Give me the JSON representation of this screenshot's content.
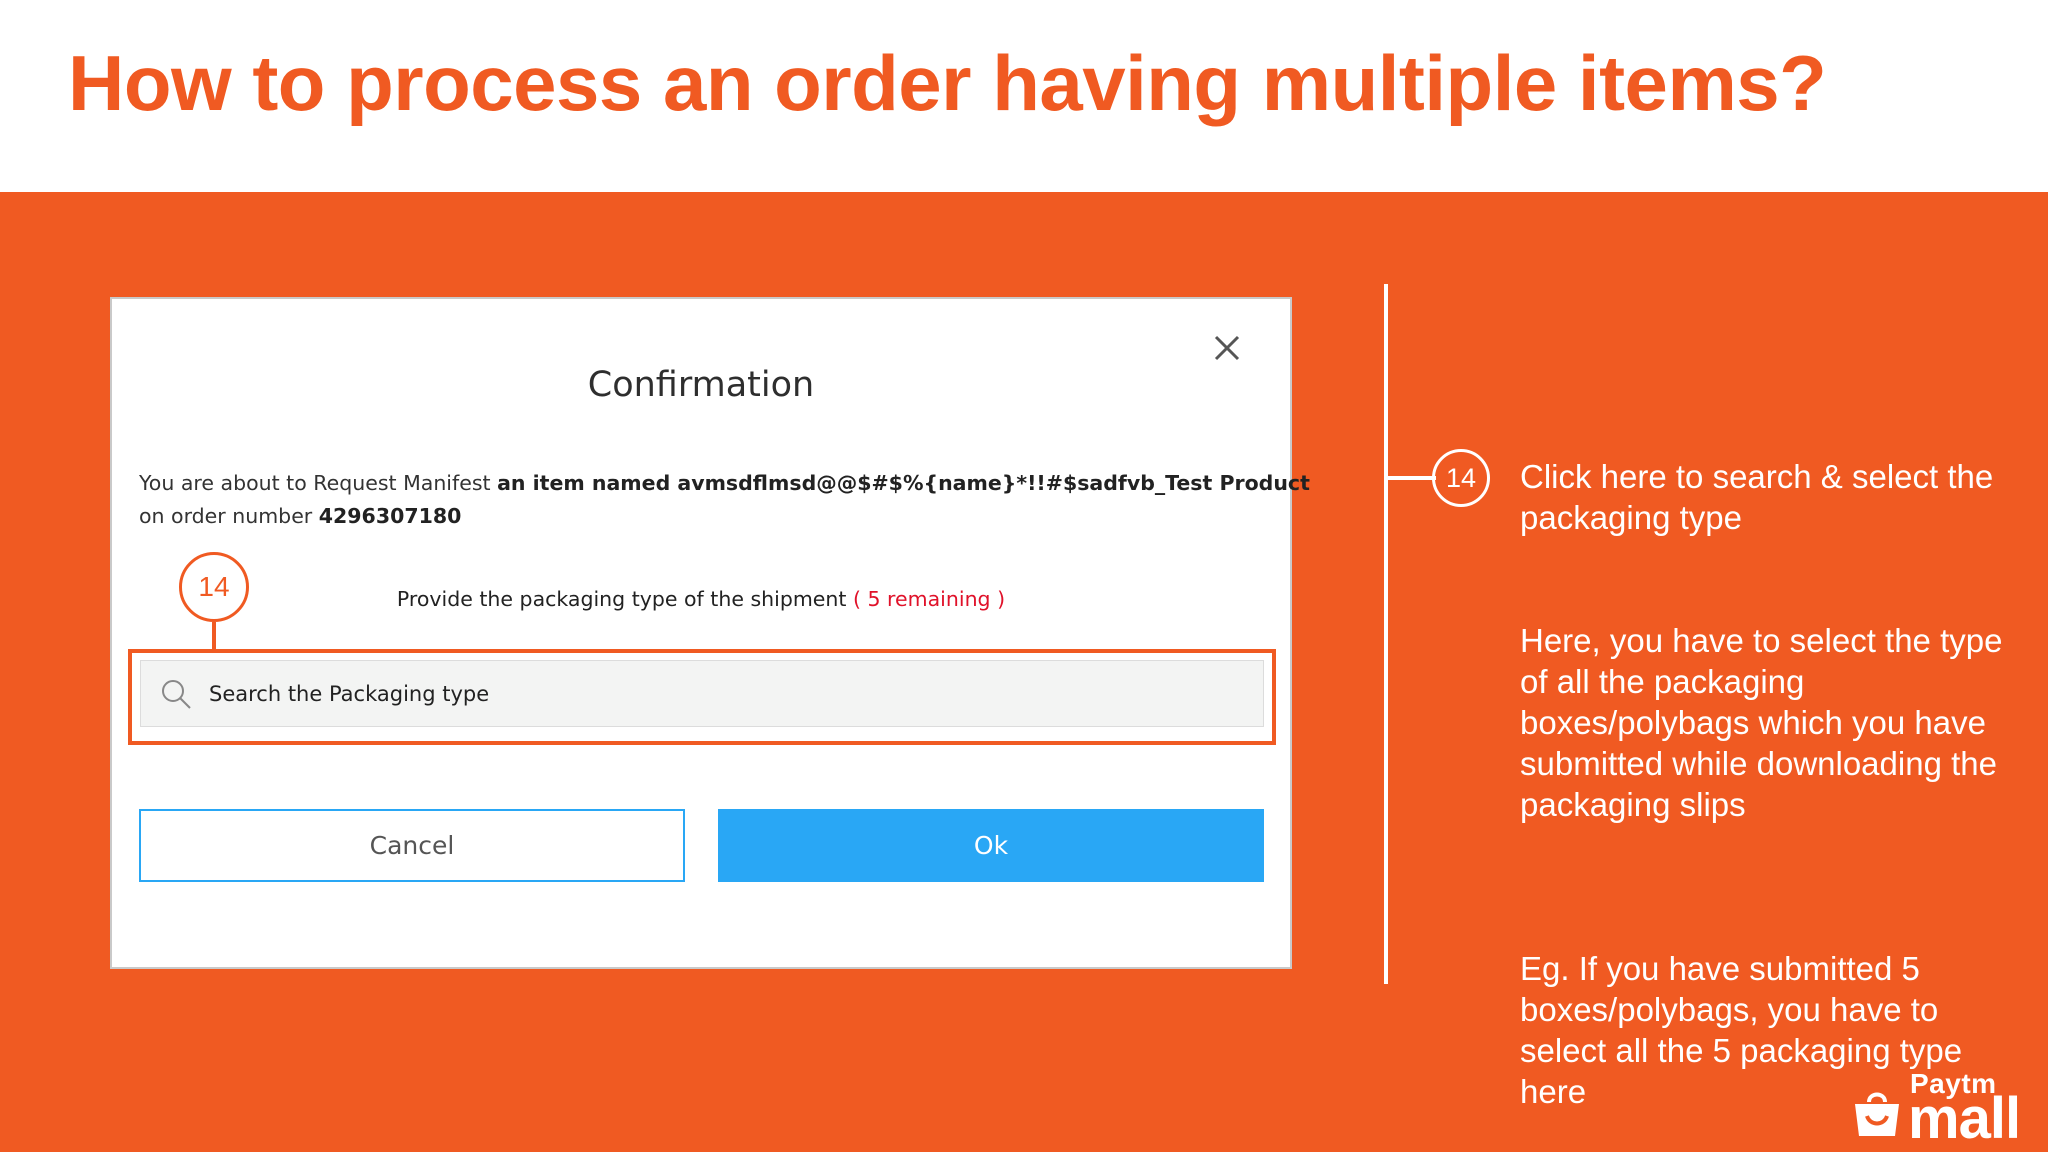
{
  "slide": {
    "title": "How to process an order having multiple items?"
  },
  "dialog": {
    "title": "Confirmation",
    "message_prefix": "You are about to Request Manifest ",
    "message_item": "an item named avmsdflmsd@@$#$%{name}*!!#$sadfvb_Test Product",
    "message_order_prefix": "on order number ",
    "order_number": "4296307180",
    "packaging_prompt": "Provide the packaging type of the shipment",
    "remaining": "( 5 remaining )",
    "search_placeholder": "Search the Packaging type",
    "cancel_label": "Cancel",
    "ok_label": "Ok",
    "callout_number": "14"
  },
  "annotations": {
    "step_number": "14",
    "note_1": "Click here to search & select the packaging type",
    "note_2": "Here, you have to select the type of all the packaging boxes/polybags which you have submitted while downloading the packaging slips",
    "note_3": "Eg. If you have submitted 5 boxes/polybags, you have to select all the 5 packaging type here"
  },
  "logo": {
    "line1": "Paytm",
    "line2": "mall"
  },
  "colors": {
    "brand_orange": "#f05a22",
    "button_blue": "#29a7f5",
    "remaining_red": "#e0122a"
  },
  "icons": {
    "close": "close-icon",
    "search": "search-icon",
    "logo_bag": "shopping-bag-icon"
  }
}
